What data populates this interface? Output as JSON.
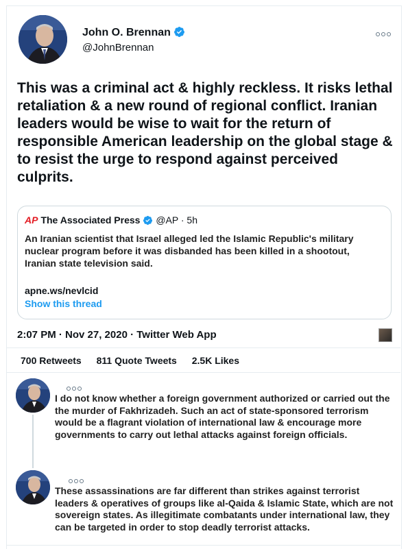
{
  "tweet": {
    "author_name": "John O. Brennan",
    "author_handle": "@JohnBrennan",
    "text": "This was a criminal act & highly reckless. It risks lethal retaliation & a new round of regional conflict. Iranian leaders would be wise to wait for the return of responsible American leadership on the global stage & to resist the urge to respond against perceived culprits.",
    "timestamp": "2:07 PM · Nov 27, 2020 · Twitter Web App",
    "stats": {
      "retweets": "700 Retweets",
      "quote_tweets": "811 Quote Tweets",
      "likes": "2.5K Likes"
    }
  },
  "quoted": {
    "logo": "AP",
    "name": "The Associated Press",
    "handle_time": "@AP · 5h",
    "text": "An Iranian scientist that Israel alleged led the Islamic Republic's military nuclear program before it was disbanded has been killed in a shootout, Iranian state television said.",
    "link": "apne.ws/nevlcid",
    "show_thread": "Show this thread"
  },
  "replies": [
    {
      "text": "I do not know whether a foreign government authorized or carried out the the murder of Fakhrizadeh. Such an act of state-sponsored terrorism would be a flagrant violation of international law & encourage more governments to carry out lethal attacks against foreign officials."
    },
    {
      "text": "These assassinations are far different than strikes against terrorist leaders & operatives of groups like al-Qaida & Islamic State, which are not sovereign states. As illegitimate combatants under international law, they can be targeted in order to stop deadly terrorist attacks."
    }
  ],
  "colors": {
    "accent": "#1d9bf0",
    "ap_red": "#e31b23",
    "border": "#cfd9de"
  },
  "icons": [
    "verified-badge-icon",
    "more-options-icon",
    "media-thumbnail-icon"
  ]
}
